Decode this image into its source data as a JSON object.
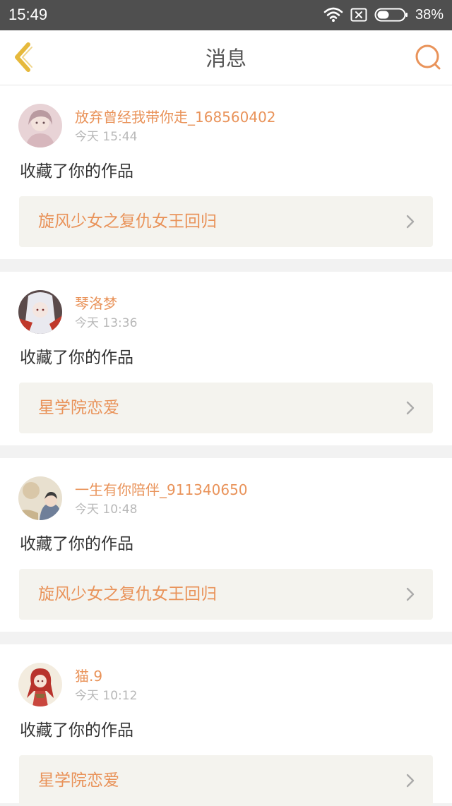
{
  "status_bar": {
    "time": "15:49",
    "battery": "38%",
    "icons": [
      "wifi-icon",
      "no-sim-icon",
      "battery-icon"
    ]
  },
  "nav": {
    "title": "消息",
    "back_icon": "chevron-left-icon",
    "search_icon": "search-icon"
  },
  "colors": {
    "accent": "#e9935a",
    "back_icon": "#e6b93c",
    "status_bar": "#4f4f4f",
    "work_box": "#f4f3ee"
  },
  "messages": [
    {
      "user": "放弃曾经我带你走_168560402",
      "time": "今天 15:44",
      "action": "收藏了你的作品",
      "work": "旋风少女之复仇女王回归"
    },
    {
      "user": "琴洛梦",
      "time": "今天 13:36",
      "action": "收藏了你的作品",
      "work": "星学院恋爱"
    },
    {
      "user": "一生有你陪伴_911340650",
      "time": "今天 10:48",
      "action": "收藏了你的作品",
      "work": "旋风少女之复仇女王回归"
    },
    {
      "user": "猫.9",
      "time": "今天 10:12",
      "action": "收藏了你的作品",
      "work": "星学院恋爱"
    }
  ]
}
